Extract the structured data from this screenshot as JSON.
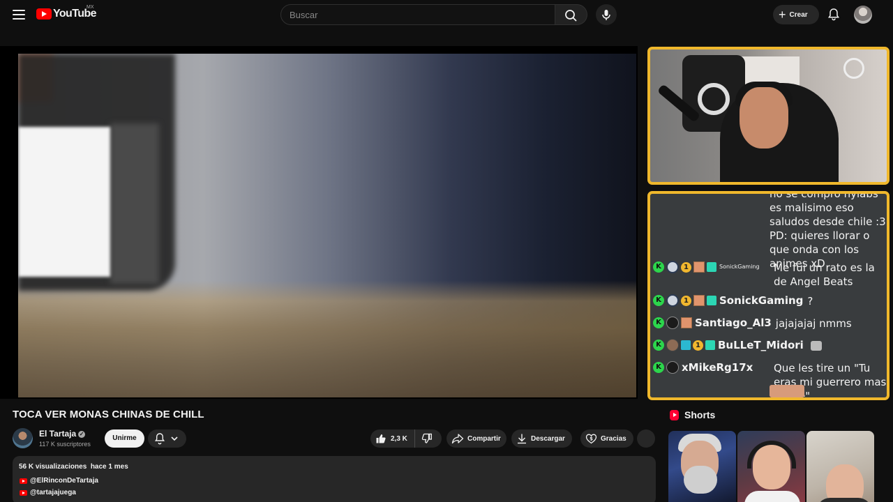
{
  "header": {
    "logo_text": "YouTube",
    "region": "MX",
    "search_placeholder": "Buscar",
    "create_label": "Crear"
  },
  "video": {
    "title": "TOCA VER MONAS CHINAS DE CHILL"
  },
  "chat": {
    "top_message": "no se compro nylabs es malisimo eso saludos desde chile :3 PD: quieres llorar o que onda con los animes xD",
    "messages": [
      {
        "user": "SonickGaming",
        "text": "Me fui un rato es la de Angel Beats",
        "sub_months": "1"
      },
      {
        "user": "SonickGaming",
        "text": "?",
        "sub_months": "1"
      },
      {
        "user": "Santiago_Al3",
        "text": "jajajajaj nmms"
      },
      {
        "user": "BuLLeT_Midori",
        "text": "",
        "sub_months": "1"
      },
      {
        "user": "xMikeRg17x",
        "text": "Que les tire un \"Tu eras mi guerrero mas fuerte\""
      }
    ],
    "kick_badge": "K",
    "accent_color": "#f0b82c",
    "kick_color": "#2cd64c"
  },
  "channel": {
    "name": "El Tartaja",
    "subscribers": "117 K suscriptores",
    "join_label": "Unirme"
  },
  "actions": {
    "likes": "2,3 K",
    "share": "Compartir",
    "download": "Descargar",
    "thanks": "Gracias"
  },
  "description": {
    "stats": "56 K visualizaciones  hace 1 mes",
    "links": [
      "@ElRinconDeTartaja",
      "@tartajajuega"
    ]
  },
  "shorts": {
    "heading": "Shorts"
  },
  "colors": {
    "background": "#0f0f0f",
    "brand_red": "#ff0000"
  }
}
